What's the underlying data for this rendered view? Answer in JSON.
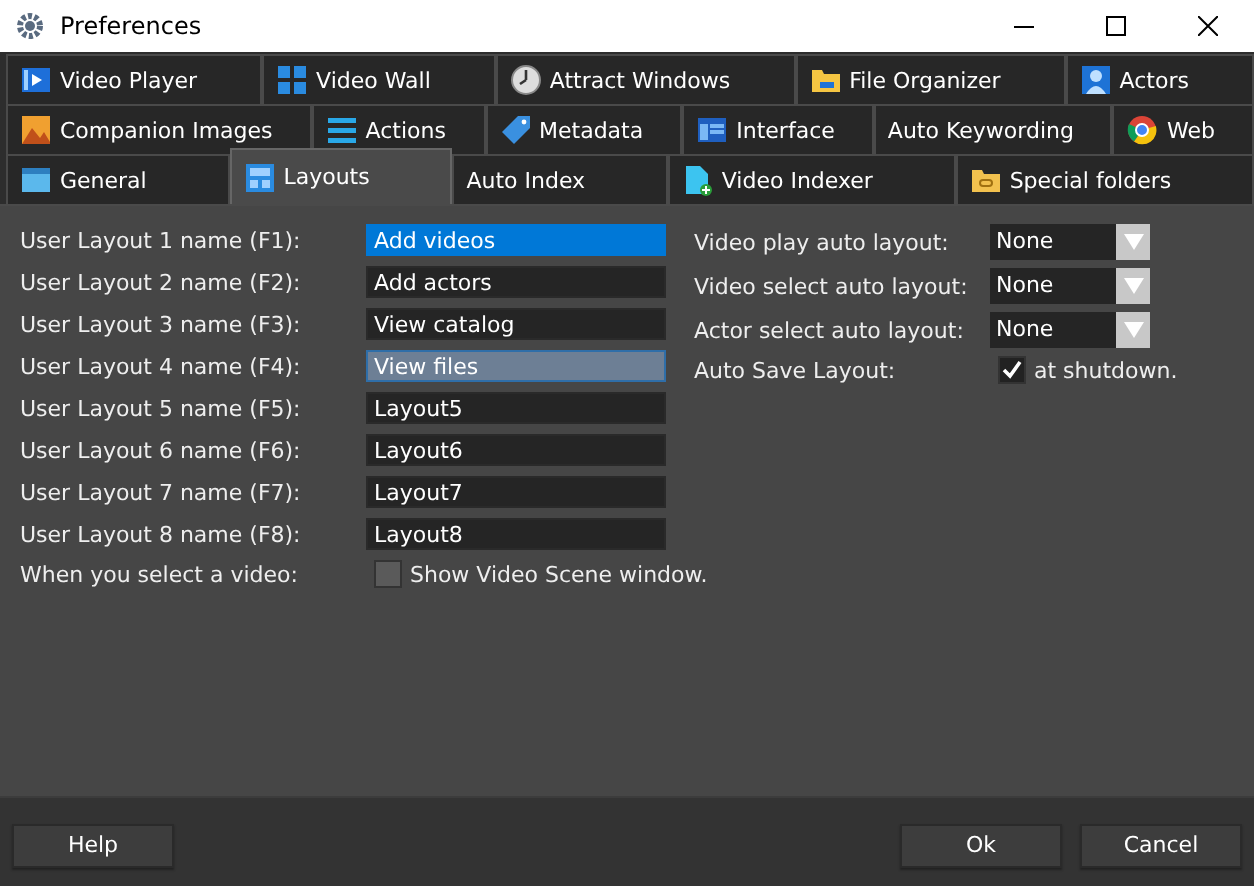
{
  "window": {
    "title": "Preferences"
  },
  "tab_rows": [
    [
      {
        "label": "Video Player",
        "selected": false
      },
      {
        "label": "Video Wall",
        "selected": false
      },
      {
        "label": "Attract Windows",
        "selected": false
      },
      {
        "label": "File Organizer",
        "selected": false
      },
      {
        "label": "Actors",
        "selected": false
      }
    ],
    [
      {
        "label": "Companion Images",
        "selected": false
      },
      {
        "label": "Actions",
        "selected": false
      },
      {
        "label": "Metadata",
        "selected": false
      },
      {
        "label": "Interface",
        "selected": false
      },
      {
        "label": "Auto Keywording",
        "selected": false
      },
      {
        "label": "Web",
        "selected": false
      }
    ],
    [
      {
        "label": "General",
        "selected": false
      },
      {
        "label": "Layouts",
        "selected": true
      },
      {
        "label": "Auto Index",
        "selected": false
      },
      {
        "label": "Video Indexer",
        "selected": false
      },
      {
        "label": "Special folders",
        "selected": false
      }
    ]
  ],
  "layout_names": [
    {
      "label": "User Layout 1 name (F1):",
      "value": "Add videos",
      "selected": true,
      "focused": false
    },
    {
      "label": "User Layout 2 name (F2):",
      "value": "Add actors",
      "selected": false,
      "focused": false
    },
    {
      "label": "User Layout 3 name (F3):",
      "value": "View catalog",
      "selected": false,
      "focused": false
    },
    {
      "label": "User Layout 4 name (F4):",
      "value": "View files",
      "selected": false,
      "focused": true
    },
    {
      "label": "User Layout 5 name (F5):",
      "value": "Layout5",
      "selected": false,
      "focused": false
    },
    {
      "label": "User Layout 6 name (F6):",
      "value": "Layout6",
      "selected": false,
      "focused": false
    },
    {
      "label": "User Layout 7 name (F7):",
      "value": "Layout7",
      "selected": false,
      "focused": false
    },
    {
      "label": "User Layout 8 name (F8):",
      "value": "Layout8",
      "selected": false,
      "focused": false
    }
  ],
  "select_video": {
    "label": "When you select a video:",
    "option": "Show Video Scene window.",
    "checked": false
  },
  "auto_layouts": [
    {
      "label": "Video play auto layout:",
      "value": "None"
    },
    {
      "label": "Video select auto layout:",
      "value": "None"
    },
    {
      "label": "Actor select auto layout:",
      "value": "None"
    }
  ],
  "auto_save": {
    "label": "Auto Save Layout:",
    "option": "at shutdown.",
    "checked": true
  },
  "buttons": {
    "help": "Help",
    "ok": "Ok",
    "cancel": "Cancel"
  }
}
